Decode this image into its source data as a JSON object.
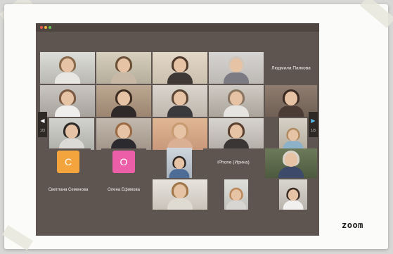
{
  "colors": {
    "window_bg": "#5e5450",
    "tile_bg": "#6b605b",
    "avatar_orange": "#f3a43c",
    "avatar_pink": "#ec5fa8",
    "arrow_accent": "#57c1ec"
  },
  "meeting": {
    "named_tiles": [
      {
        "id": "ludmila",
        "name": "Людмила Панкова"
      },
      {
        "id": "iphone",
        "name": "iPhone (Ирина)"
      }
    ],
    "avatar_tiles": [
      {
        "id": "svetlana",
        "initial": "С",
        "name": "Светлана Семенова",
        "color": "#f3a43c"
      },
      {
        "id": "olena",
        "initial": "О",
        "name": "Олена Ефимова",
        "color": "#ec5fa8"
      }
    ],
    "pagination": {
      "prev_icon": "chevron-left-icon",
      "next_icon": "chevron-right-icon",
      "prev_arrow": "◀",
      "next_arrow": "▶",
      "prev_label": "1/3",
      "next_label": "1/3"
    }
  },
  "brand": {
    "text": "zoom"
  }
}
